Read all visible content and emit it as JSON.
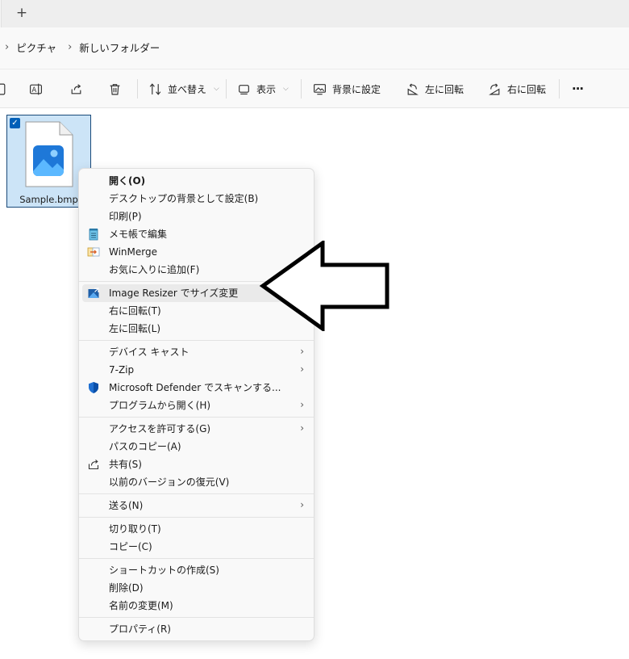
{
  "breadcrumb": {
    "items": [
      "ピクチャ",
      "新しいフォルダー"
    ]
  },
  "toolbar": {
    "sort_label": "並べ替え",
    "view_label": "表示",
    "set_background_label": "背景に設定",
    "rotate_left_label": "左に回転",
    "rotate_right_label": "右に回転",
    "more_label": "···"
  },
  "file": {
    "name": "Sample.bmp",
    "selected": true
  },
  "context_menu": {
    "open": "開く(O)",
    "set_desktop_bg": "デスクトップの背景として設定(B)",
    "print": "印刷(P)",
    "edit_notepad": "メモ帳で編集",
    "winmerge": "WinMerge",
    "add_favorites": "お気に入りに追加(F)",
    "image_resizer": "Image Resizer でサイズ変更",
    "rotate_right": "右に回転(T)",
    "rotate_left": "左に回転(L)",
    "device_cast": "デバイス キャスト",
    "seven_zip": "7-Zip",
    "defender_scan": "Microsoft Defender でスキャンする...",
    "open_with": "プログラムから開く(H)",
    "give_access": "アクセスを許可する(G)",
    "copy_path": "パスのコピー(A)",
    "share": "共有(S)",
    "restore_versions": "以前のバージョンの復元(V)",
    "send_to": "送る(N)",
    "cut": "切り取り(T)",
    "copy": "コピー(C)",
    "create_shortcut": "ショートカットの作成(S)",
    "delete": "削除(D)",
    "rename": "名前の変更(M)",
    "properties": "プロパティ(R)"
  },
  "colors": {
    "accent": "#005fb8",
    "selection": "#cce4f7",
    "hover": "#eaeaea"
  }
}
